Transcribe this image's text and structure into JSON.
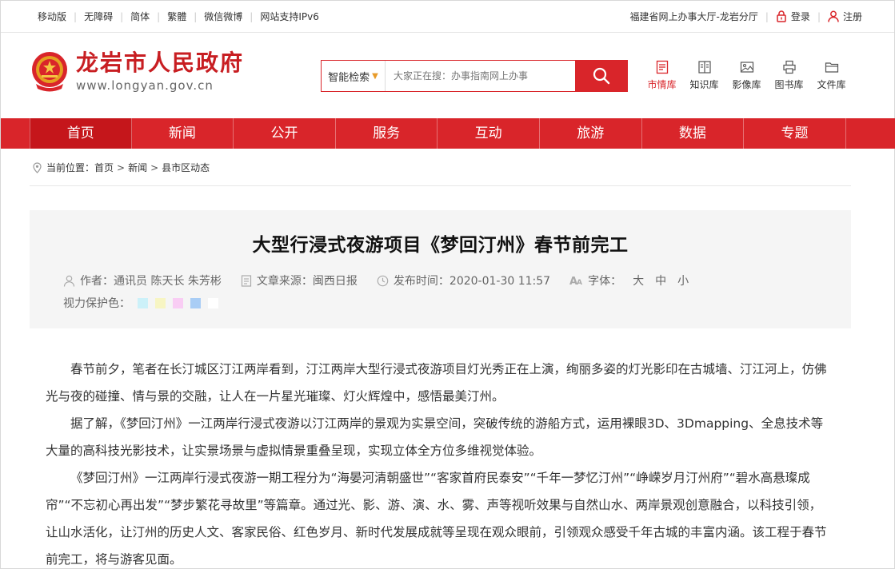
{
  "topbar": {
    "links": [
      "移动版",
      "无障碍",
      "简体",
      "繁體",
      "微信微博",
      "网站支持IPv6"
    ],
    "portal": "福建省网上办事大厅-龙岩分厅",
    "login": "登录",
    "register": "注册"
  },
  "header": {
    "site_title": "龙岩市人民政府",
    "site_url": "www.longyan.gov.cn",
    "search": {
      "scope": "智能检索",
      "placeholder": "大家正在搜：办事指南网上办事"
    },
    "libraries": [
      {
        "label": "市情库",
        "icon": "city-info-icon",
        "active": true
      },
      {
        "label": "知识库",
        "icon": "book-icon",
        "active": false
      },
      {
        "label": "影像库",
        "icon": "image-icon",
        "active": false
      },
      {
        "label": "图书库",
        "icon": "printer-icon",
        "active": false
      },
      {
        "label": "文件库",
        "icon": "folder-icon",
        "active": false
      }
    ]
  },
  "nav": {
    "items": [
      "首页",
      "新闻",
      "公开",
      "服务",
      "互动",
      "旅游",
      "数据",
      "专题"
    ],
    "active": "首页"
  },
  "breadcrumb": {
    "label": "当前位置：",
    "items": [
      "首页",
      "新闻",
      "县市区动态"
    ]
  },
  "article": {
    "title": "大型行浸式夜游项目《梦回汀州》春节前完工",
    "author": "作者：通讯员 陈天长 朱芳彬",
    "source": "文章来源：闽西日报",
    "published": "发布时间：2020-01-30 11:57",
    "font_label": "字体：",
    "font_sizes": [
      "大",
      "中",
      "小"
    ],
    "protect_label": "视力保护色：",
    "protect_colors": [
      "#ccf1f9",
      "#f7f5c3",
      "#f9cdf4",
      "#a9cdf5",
      "#ffffff"
    ],
    "paragraphs": [
      "春节前夕，笔者在长汀城区汀江两岸看到，汀江两岸大型行浸式夜游项目灯光秀正在上演，绚丽多姿的灯光影印在古城墙、汀江河上，仿佛光与夜的碰撞、情与景的交融，让人在一片星光璀璨、灯火辉煌中，感悟最美汀州。",
      "据了解，《梦回汀州》一江两岸行浸式夜游以汀江两岸的景观为实景空间，突破传统的游船方式，运用裸眼3D、3Dmapping、全息技术等大量的高科技光影技术，让实景场景与虚拟情景重叠呈现，实现立体全方位多维视觉体验。",
      "《梦回汀州》一江两岸行浸式夜游一期工程分为“海晏河清朝盛世”“客家首府民泰安”“千年一梦忆汀州”“峥嵘岁月汀州府”“碧水高悬璨成帘”“不忘初心再出发”“梦步繁花寻故里”等篇章。通过光、影、游、演、水、雾、声等视听效果与自然山水、两岸景观创意融合，以科技引领，让山水活化，让汀州的历史人文、客家民俗、红色岁月、新时代发展成就等呈现在观众眼前，引领观众感受千年古城的丰富内涵。该工程于春节前完工，将与游客见面。"
    ]
  }
}
